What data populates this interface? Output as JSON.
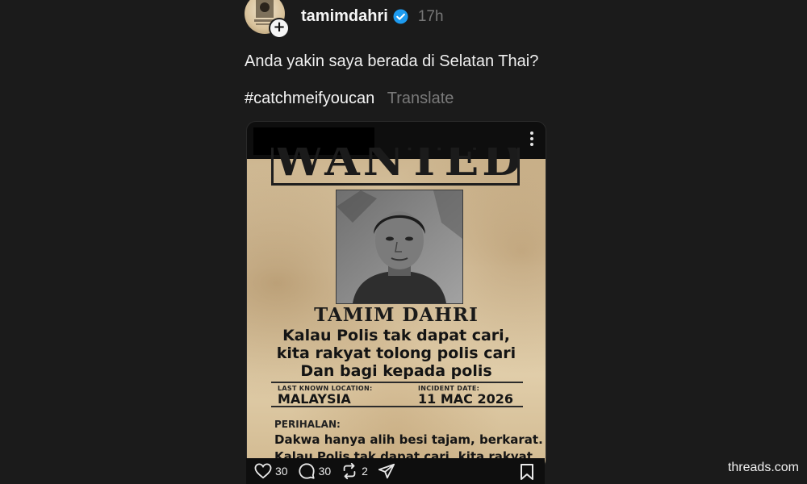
{
  "post": {
    "username": "tamimdahri",
    "timestamp": "17h",
    "verified_color": "#1d9bf0",
    "caption": "Anda yakin saya berada di Selatan Thai?",
    "hashtag": "#catchmeifyoucan",
    "translate_label": "Translate"
  },
  "poster": {
    "heading": "WANTED",
    "name": "TAMIM DAHRI",
    "slogan": [
      "Kalau Polis tak dapat cari,",
      "kita rakyat tolong polis cari",
      "Dan bagi kepada polis"
    ],
    "location_label": "LAST KNOWN LOCATION:",
    "location_value": "MALAYSIA",
    "date_label": "INCIDENT DATE:",
    "date_value": "11 MAC 2026",
    "description_label": "PERIHALAN:",
    "description_lines": [
      "Dakwa hanya alih besi tajam, berkarat.",
      "Kalau Polis tak dapat cari, kita rakyat"
    ]
  },
  "actions": {
    "likes": "30",
    "replies": "30",
    "reposts": "2"
  },
  "watermark": "threads.com"
}
